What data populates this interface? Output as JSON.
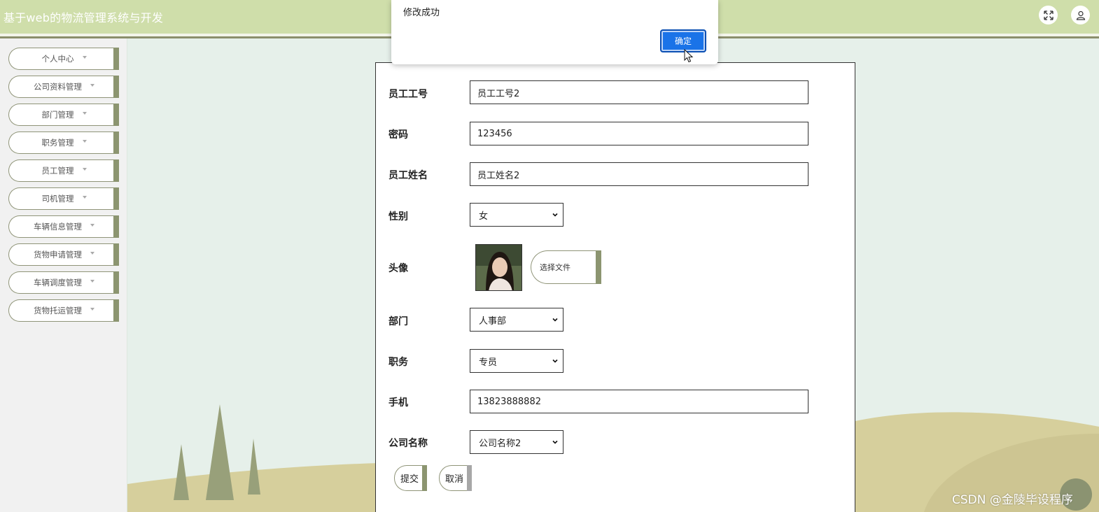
{
  "app": {
    "title": "基于web的物流管理系统与开发",
    "header_icons": [
      "fullscreen-icon",
      "user-icon"
    ]
  },
  "sidebar": {
    "items": [
      {
        "label": "个人中心"
      },
      {
        "label": "公司资料管理"
      },
      {
        "label": "部门管理"
      },
      {
        "label": "职务管理"
      },
      {
        "label": "员工管理"
      },
      {
        "label": "司机管理"
      },
      {
        "label": "车辆信息管理"
      },
      {
        "label": "货物申请管理"
      },
      {
        "label": "车辆调度管理"
      },
      {
        "label": "货物托运管理"
      }
    ]
  },
  "form": {
    "employee_no": {
      "label": "员工工号",
      "value": "员工工号2"
    },
    "password": {
      "label": "密码",
      "value": "123456"
    },
    "employee_name": {
      "label": "员工姓名",
      "value": "员工姓名2"
    },
    "gender": {
      "label": "性别",
      "value": "女"
    },
    "avatar": {
      "label": "头像",
      "file_button": "选择文件"
    },
    "department": {
      "label": "部门",
      "value": "人事部"
    },
    "position": {
      "label": "职务",
      "value": "专员"
    },
    "phone": {
      "label": "手机",
      "value": "13823888882"
    },
    "company": {
      "label": "公司名称",
      "value": "公司名称2"
    },
    "submit_label": "提交",
    "cancel_label": "取消"
  },
  "dialog": {
    "message": "修改成功",
    "ok_label": "确定"
  },
  "watermark": "CSDN @金陵毕设程序",
  "colors": {
    "header_bg": "#cfdeaa",
    "accent": "#8c9570",
    "dialog_button": "#1a73e8",
    "page_bg": "#e6f0ea"
  }
}
